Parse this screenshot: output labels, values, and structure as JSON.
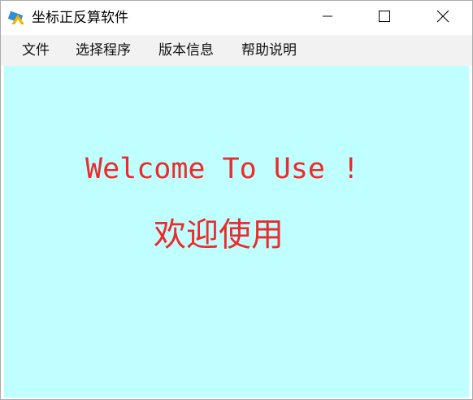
{
  "window": {
    "title": "坐标正反算软件",
    "icon": "ruler-protractor-icon",
    "controls": [
      "minimize-icon",
      "maximize-icon",
      "close-icon"
    ]
  },
  "menu": {
    "items": [
      "文件",
      "选择程序",
      "版本信息",
      "帮助说明"
    ]
  },
  "content": {
    "welcome_en": "Welcome To Use !",
    "welcome_cn": "欢迎使用"
  },
  "colors": {
    "client_background": "#bfffff",
    "menubar_background": "#f2f2f2",
    "welcome_text": "#ee2a2a"
  }
}
